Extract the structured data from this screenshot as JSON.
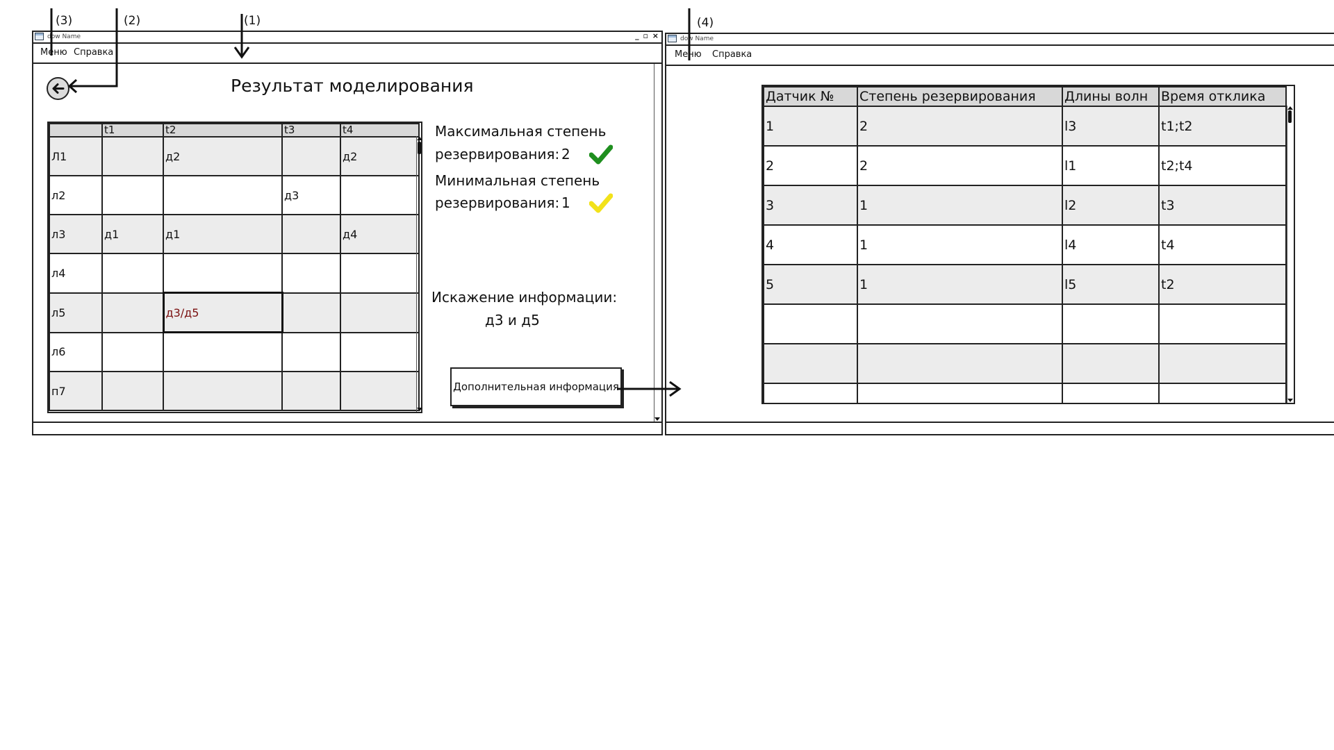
{
  "callouts": {
    "c1": "(1)",
    "c2": "(2)",
    "c3": "(3)",
    "c4": "(4)"
  },
  "colors": {
    "check_green": "#1f8f1f",
    "check_yellow": "#f2e21a",
    "error_cell": "#e08a8a",
    "header_bg": "#d8d8d8",
    "row_shade": "#ececec"
  },
  "left_window": {
    "title": "dow Name",
    "controls": "_ ▫ ×",
    "menu": {
      "menu": "Меню",
      "help": "Справка"
    },
    "back_icon": "arrow-left-circle-icon",
    "heading": "Результат моделирования",
    "grid": {
      "headers": [
        "",
        "t1",
        "t2",
        "t3",
        "t4"
      ],
      "rows": [
        [
          "Л1",
          "",
          "д2",
          "",
          "д2"
        ],
        [
          "л2",
          "",
          "",
          "д3",
          ""
        ],
        [
          "л3",
          "д1",
          "д1",
          "",
          "д4"
        ],
        [
          "л4",
          "",
          "",
          "",
          ""
        ],
        [
          "л5",
          "",
          "д3/д5",
          "",
          ""
        ],
        [
          "л6",
          "",
          "",
          "",
          ""
        ],
        [
          "п7",
          "",
          "",
          "",
          ""
        ]
      ]
    },
    "max_line1": "Максимальная степень",
    "max_line2": "резервирования:",
    "max_value": "2",
    "max_icon": "check-green-icon",
    "min_line1": "Минимальная степень",
    "min_line2": "резервирования:",
    "min_value": "1",
    "min_icon": "check-yellow-icon",
    "distortion_line1": "Искажение информации:",
    "distortion_line2": "д3 и д5",
    "more_button": "Дополнительная информация"
  },
  "right_window": {
    "title": "dow Name",
    "menu": {
      "menu": "Меню",
      "help": "Справка"
    },
    "table": {
      "headers": [
        "Датчик №",
        "Степень резервирования",
        "Длины волн",
        "Время отклика"
      ],
      "rows": [
        [
          "1",
          "2",
          "l3",
          "t1;t2"
        ],
        [
          "2",
          "2",
          "l1",
          "t2;t4"
        ],
        [
          "3",
          "1",
          "l2",
          "t3"
        ],
        [
          "4",
          "1",
          "l4",
          "t4"
        ],
        [
          "5",
          "1",
          "l5",
          "t2"
        ],
        [
          "",
          "",
          "",
          ""
        ],
        [
          "",
          "",
          "",
          ""
        ],
        [
          "",
          "",
          "",
          ""
        ]
      ]
    }
  }
}
